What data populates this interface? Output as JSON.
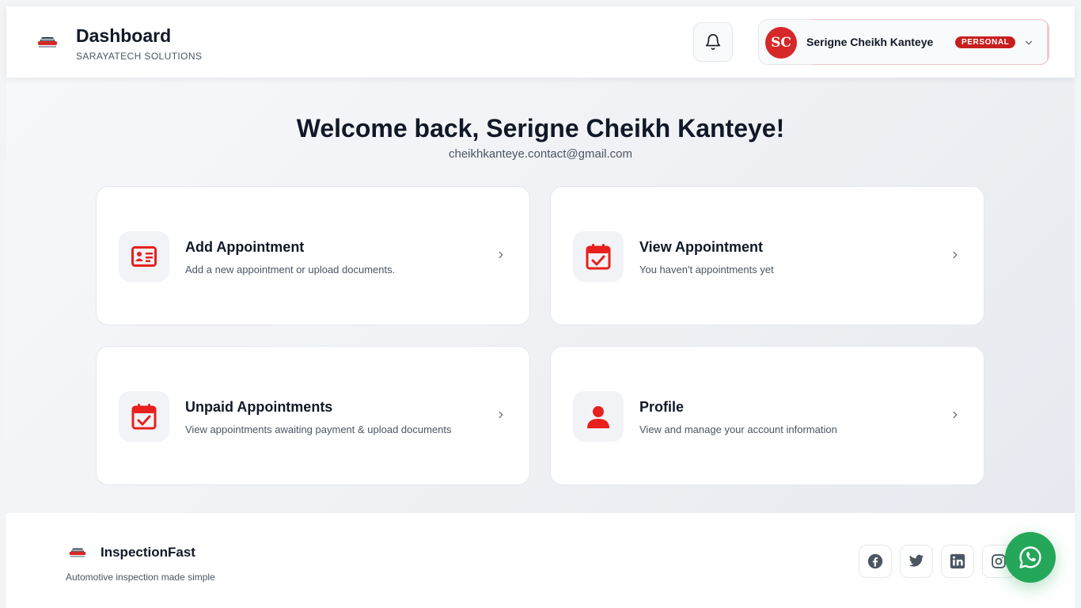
{
  "header": {
    "title": "Dashboard",
    "subtitle": "SARAYATECH SOLUTIONS",
    "user": {
      "initials": "SC",
      "name": "Serigne Cheikh Kanteye",
      "badge": "PERSONAL"
    }
  },
  "main": {
    "welcome": "Welcome back, Serigne Cheikh Kanteye!",
    "email": "cheikhkanteye.contact@gmail.com",
    "cards": [
      {
        "title": "Add Appointment",
        "description": "Add a new appointment or upload documents.",
        "icon": "id-card-icon"
      },
      {
        "title": "View Appointment",
        "description": "You haven't appointments yet",
        "icon": "calendar-check-icon"
      },
      {
        "title": "Unpaid Appointments",
        "description": "View appointments awaiting payment & upload documents",
        "icon": "calendar-check-icon"
      },
      {
        "title": "Profile",
        "description": "View and manage your account information",
        "icon": "user-icon"
      }
    ]
  },
  "footer": {
    "brand": "InspectionFast",
    "tagline": "Automotive inspection made simple",
    "social": [
      "facebook-icon",
      "twitter-icon",
      "linkedin-icon",
      "instagram-icon"
    ]
  },
  "colors": {
    "accent_red": "#e8201e",
    "badge_red": "#c81e1e",
    "whatsapp_green": "#25a75a",
    "text_dark": "#111827",
    "text_muted": "#4b5563"
  }
}
